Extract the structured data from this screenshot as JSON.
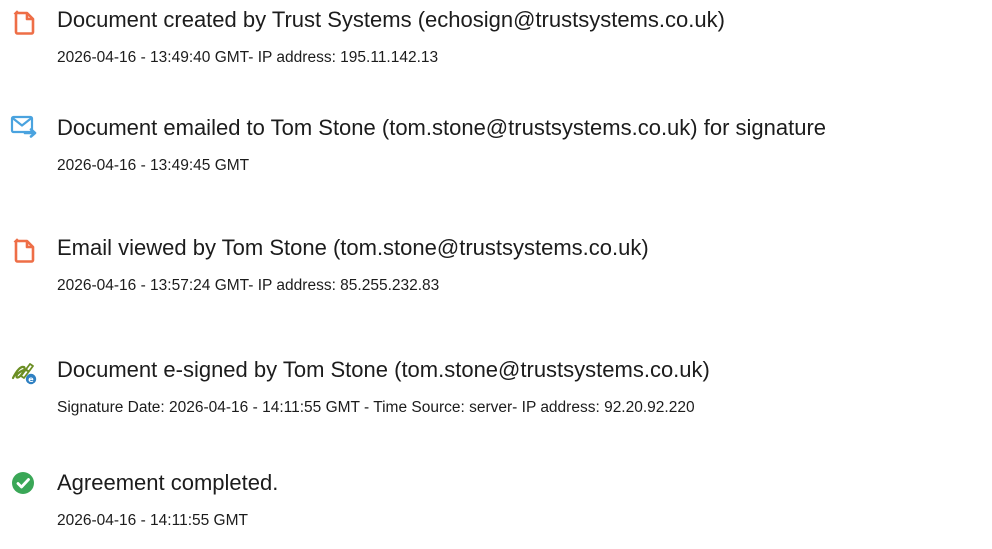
{
  "events": [
    {
      "icon": "document-created-icon",
      "title": "Document created by Trust Systems (echosign@trustsystems.co.uk)",
      "detail": "2026-04-16 - 13:49:40 GMT- IP address: 195.11.142.13"
    },
    {
      "icon": "email-sent-icon",
      "title": "Document emailed to Tom Stone (tom.stone@trustsystems.co.uk) for signature",
      "detail": "2026-04-16 - 13:49:45 GMT"
    },
    {
      "icon": "email-viewed-icon",
      "title": "Email viewed by Tom Stone (tom.stone@trustsystems.co.uk)",
      "detail": "2026-04-16 - 13:57:24 GMT- IP address: 85.255.232.83"
    },
    {
      "icon": "e-signed-icon",
      "title": "Document e-signed by Tom Stone (tom.stone@trustsystems.co.uk)",
      "detail": "Signature Date: 2026-04-16 - 14:11:55 GMT - Time Source: server- IP address: 92.20.92.220"
    },
    {
      "icon": "agreement-completed-icon",
      "title": "Agreement completed.",
      "detail": "2026-04-16 - 14:11:55 GMT"
    }
  ],
  "colors": {
    "document_icon": "#ee6e47",
    "email_icon": "#4aa3df",
    "sign_icon": "#6b8e23",
    "complete_icon": "#3aa757",
    "text": "#1c1c1c"
  }
}
